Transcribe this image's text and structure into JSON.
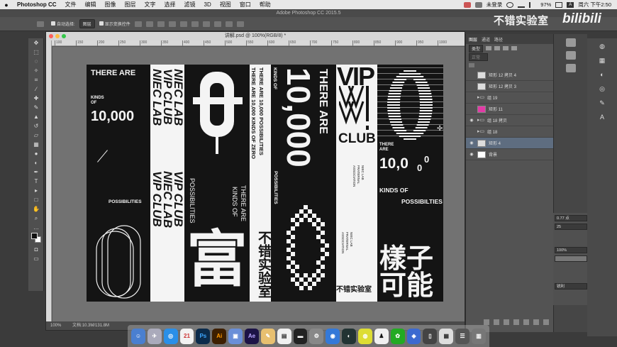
{
  "menubar": {
    "app": "Photoshop CC",
    "items": [
      "文件",
      "编辑",
      "图像",
      "图层",
      "文字",
      "选择",
      "滤镜",
      "3D",
      "视图",
      "窗口",
      "帮助"
    ],
    "user": "未登录",
    "battery": "97%",
    "clock": "周六 下午2:50"
  },
  "window_title": "Adobe Photoshop CC 2015.5",
  "options": {
    "auto_select_label": "自动选择:",
    "auto_select_value": "图层",
    "show_transform": "显示变换控件"
  },
  "document": {
    "tab_title": "讲解.psd @ 100%(RGB/8) *",
    "ruler_marks": [
      "100",
      "150",
      "200",
      "250",
      "300",
      "350",
      "400",
      "450",
      "500",
      "550",
      "600",
      "650",
      "700",
      "750",
      "800",
      "850",
      "900",
      "950",
      "1000"
    ],
    "zoom": "100%",
    "doc_size": "文档:10.3M/131.8M"
  },
  "artwork": {
    "c1_title": "THERE ARE",
    "c1_kinds": "KINDS",
    "c1_of": "OF",
    "c1_number": "10,000",
    "c1_poss": "POSSIBILITIES",
    "c2_lines": [
      "NIEC LAB",
      "VIP CLUB",
      "NIEC LAB",
      "VIP CLUB",
      "NIEC LAB",
      "VIP CLUB"
    ],
    "c3_poss": "POSSIBILITIES",
    "c3_there": "THERE ARE",
    "c3_kinds": "KINDS OF",
    "c3_fu": "富",
    "c4_line1": "THERE ARE 10,000 KINDS OF ZERO",
    "c4_line2": "THERE ARE 10,000 POSSIBILITIES",
    "c4_logo": "不错实验室",
    "c5_there": "THERE ARE",
    "c5_kinds": "KINDS OF",
    "c5_number": "10,000",
    "c5_poss": "POSSIBILITIES",
    "c6_vip": "VIP",
    "c6_club": "CLUB",
    "c6_assoc1": "NIEC LAB\nFRATERNAL\nASSOCIATION",
    "c6_logo": "不错实验室",
    "c7_there": "THERE",
    "c7_are": "ARE",
    "c7_num": "10,0",
    "c7_kinds": "KINDS OF",
    "c7_poss": "POSSIBILTIES",
    "c7_cn1": "樣子",
    "c7_cn2": "可能"
  },
  "layers": {
    "tabs": [
      "图层",
      "通道",
      "路径"
    ],
    "kind": "类型",
    "blend": "正常",
    "items": [
      {
        "name": "矩形 12 拷贝 4",
        "thumb": "normal",
        "visible": false
      },
      {
        "name": "矩形 12 拷贝 3",
        "thumb": "normal",
        "visible": false
      },
      {
        "name": "组 19",
        "thumb": "folder",
        "visible": false
      },
      {
        "name": "矩形 11",
        "thumb": "pink",
        "visible": false
      },
      {
        "name": "组 18 拷贝",
        "thumb": "folder",
        "visible": true
      },
      {
        "name": "组 18",
        "thumb": "folder",
        "visible": false
      },
      {
        "name": "矩形 4",
        "thumb": "normal",
        "visible": true
      },
      {
        "name": "背景",
        "thumb": "white",
        "visible": true
      }
    ]
  },
  "props": {
    "f1": "0.77 点",
    "f2": "25",
    "f3": "100%",
    "f4": "锐利"
  },
  "watermark": {
    "cn": "不错实验室",
    "brand": "bilibili"
  },
  "dock": [
    "Ps",
    "Ai",
    "Ae"
  ]
}
